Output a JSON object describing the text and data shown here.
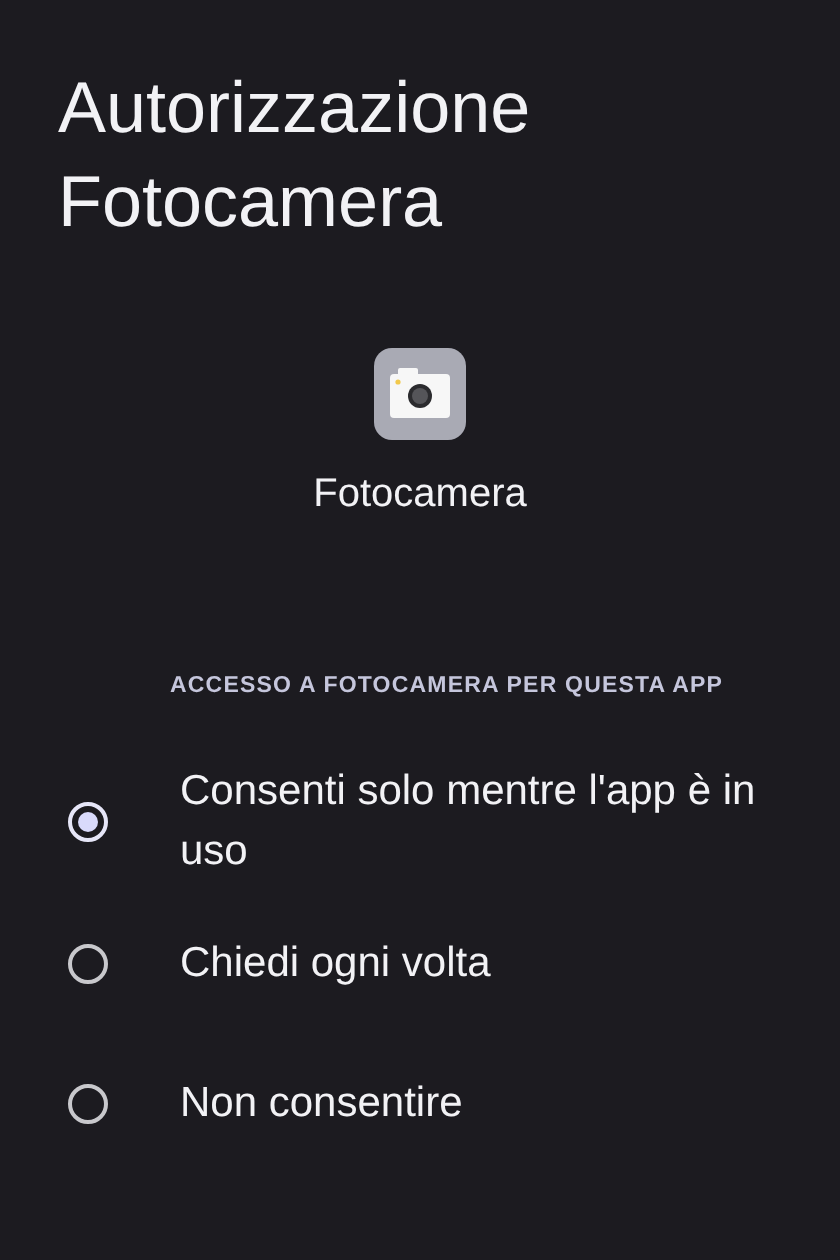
{
  "title": "Autorizzazione Fotocamera",
  "app": {
    "name": "Fotocamera"
  },
  "section": {
    "header": "ACCESSO A FOTOCAMERA PER QUESTA APP"
  },
  "options": [
    {
      "label": "Consenti solo mentre l'app è in uso",
      "selected": true
    },
    {
      "label": "Chiedi ogni volta",
      "selected": false
    },
    {
      "label": "Non consentire",
      "selected": false
    }
  ]
}
